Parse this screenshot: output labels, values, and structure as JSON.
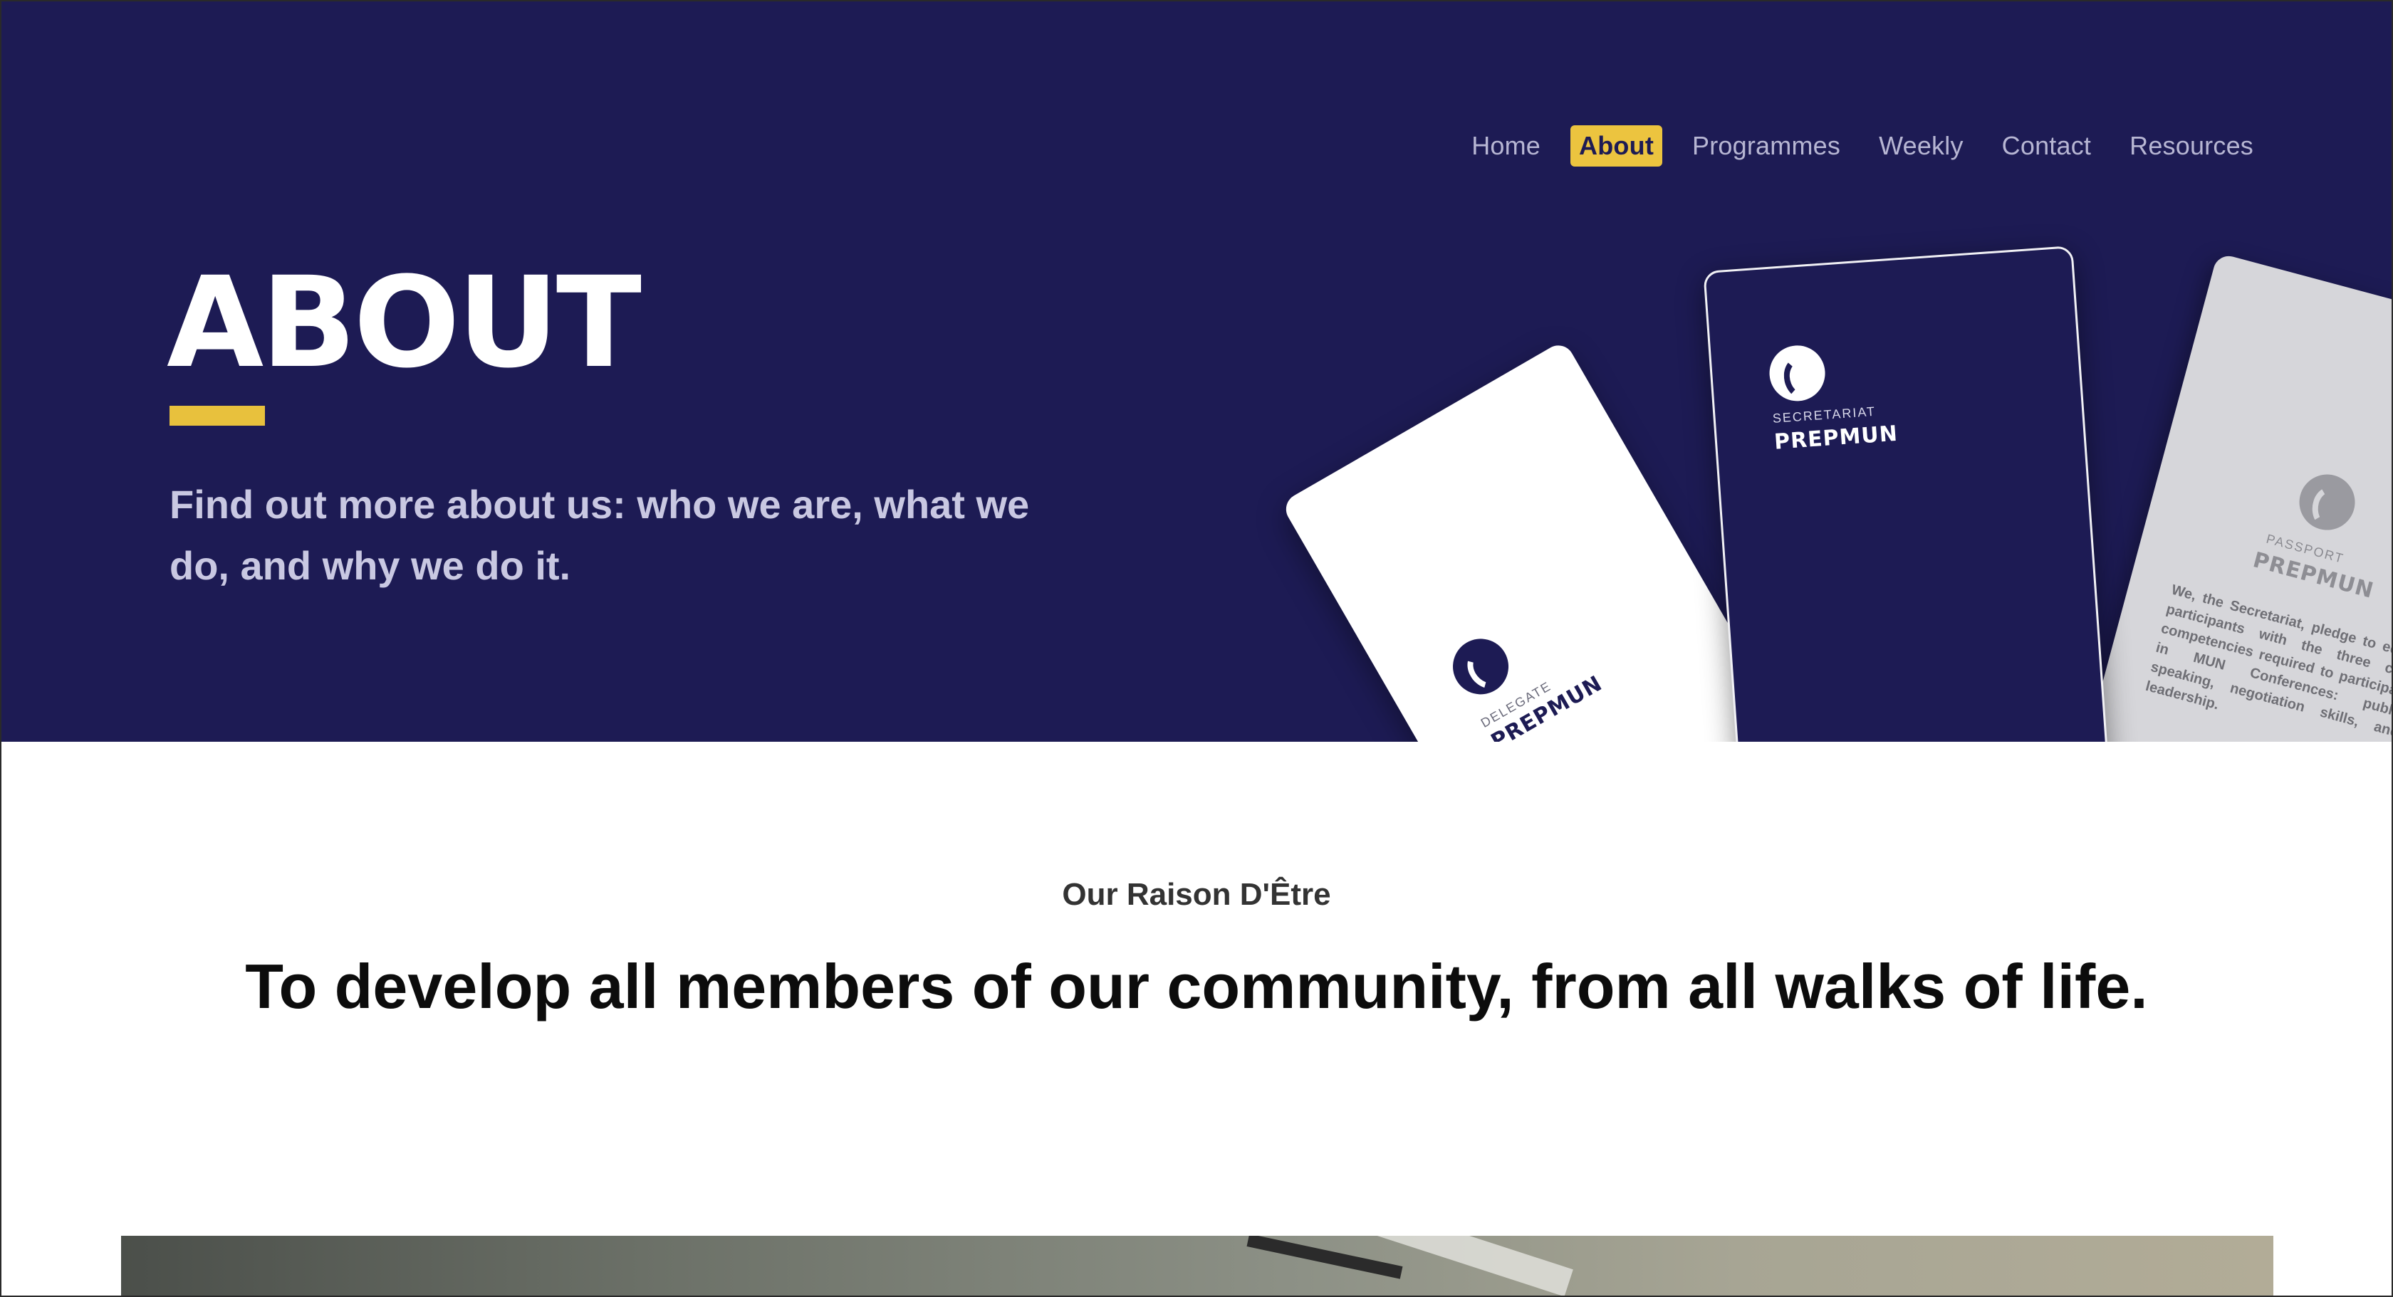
{
  "nav": {
    "items": [
      {
        "label": "Home"
      },
      {
        "label": "About"
      },
      {
        "label": "Programmes"
      },
      {
        "label": "Weekly"
      },
      {
        "label": "Contact"
      },
      {
        "label": "Resources"
      }
    ],
    "active": "About"
  },
  "hero": {
    "title": "ABOUT",
    "subtitle": "Find out more about us: who we are, what we do, and why we do it.",
    "booklets": {
      "delegate": {
        "small": "DELEGATE",
        "big": "PREPMUN"
      },
      "secretariat": {
        "small": "SECRETARIAT",
        "big": "PREPMUN"
      },
      "passport": {
        "small": "PASSPORT",
        "big": "PREPMUN",
        "pledge": "We, the Secretariat, pledge to equip participants with the three core competencies required to participate in MUN Conferences: public speaking, negotiation skills, and leadership."
      }
    }
  },
  "section": {
    "kicker": "Our Raison D'Être",
    "headline": "To develop all members of our community, from all walks of life."
  },
  "colors": {
    "hero_bg": "#1d1b54",
    "accent": "#e8c13d",
    "nav_text": "#b7b6d3"
  }
}
